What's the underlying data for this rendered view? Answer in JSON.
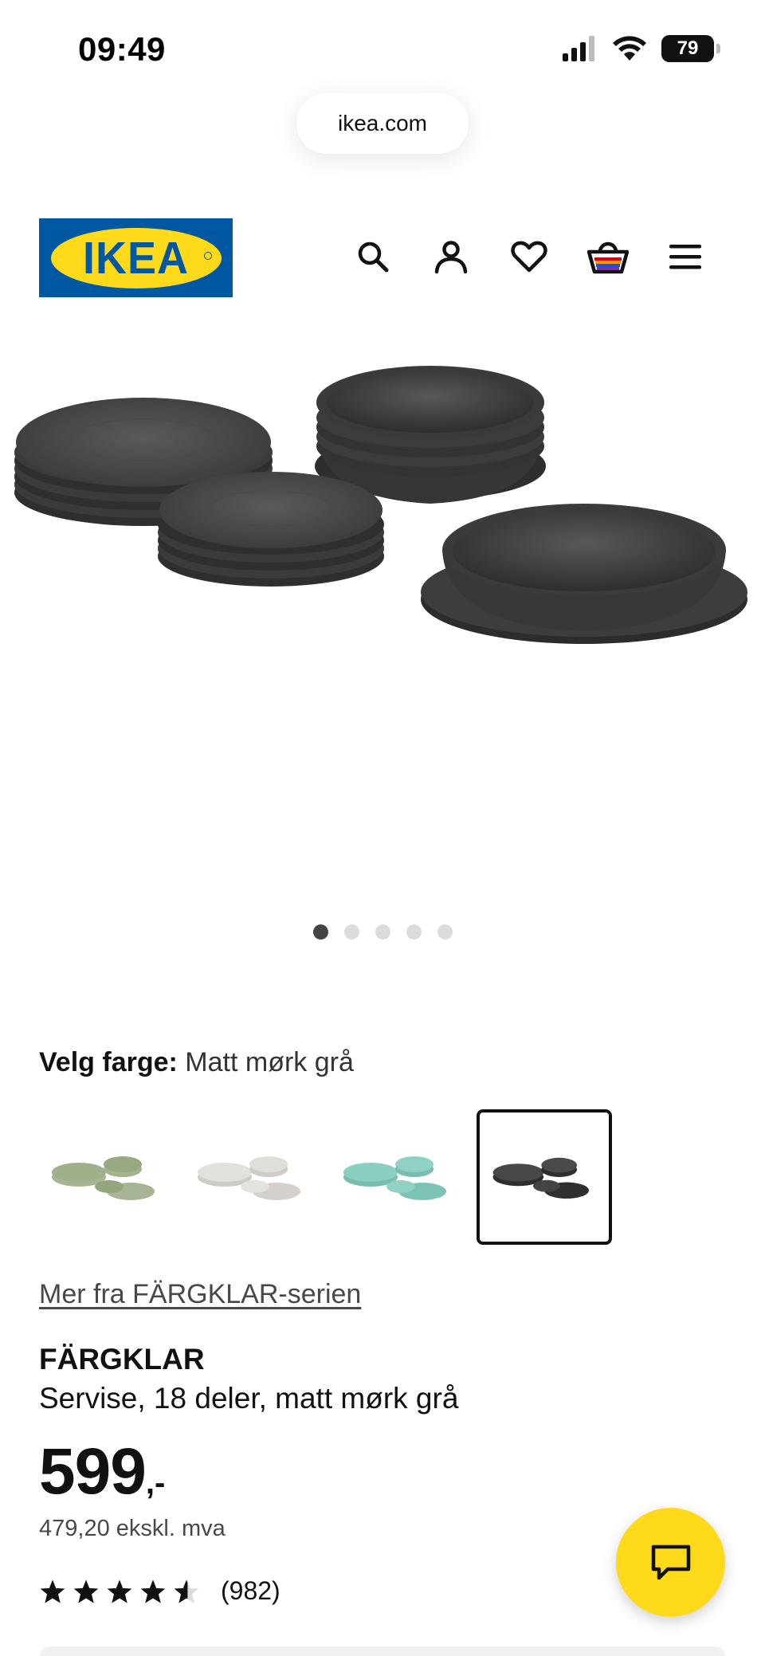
{
  "status_bar": {
    "time": "09:49",
    "battery": "79"
  },
  "browser": {
    "url": "ikea.com"
  },
  "header": {
    "logo_text": "IKEA",
    "icons": [
      "search-icon",
      "account-icon",
      "heart-icon",
      "basket-icon",
      "menu-icon"
    ]
  },
  "gallery": {
    "image_count": 5,
    "active_index": 0
  },
  "color": {
    "label": "Velg farge:",
    "value": "Matt mørk grå",
    "swatches": [
      {
        "name": "green",
        "color": "#9fb08a"
      },
      {
        "name": "light-grey",
        "color": "#dedcd8"
      },
      {
        "name": "turquoise",
        "color": "#86cbbc"
      },
      {
        "name": "dark-grey",
        "color": "#4a4a4a",
        "selected": true
      }
    ]
  },
  "series_link": "Mer fra FÄRGKLAR-serien",
  "product": {
    "name": "FÄRGKLAR",
    "description": "Servise, 18 deler, matt mørk grå",
    "price": "599",
    "price_suffix": ",-",
    "price_excl_vat": "479,20 ekskl. mva",
    "rating": 4.5,
    "rating_count": "(982)"
  },
  "colors": {
    "ikea_blue": "#0058a3",
    "ikea_yellow": "#ffda1a"
  }
}
